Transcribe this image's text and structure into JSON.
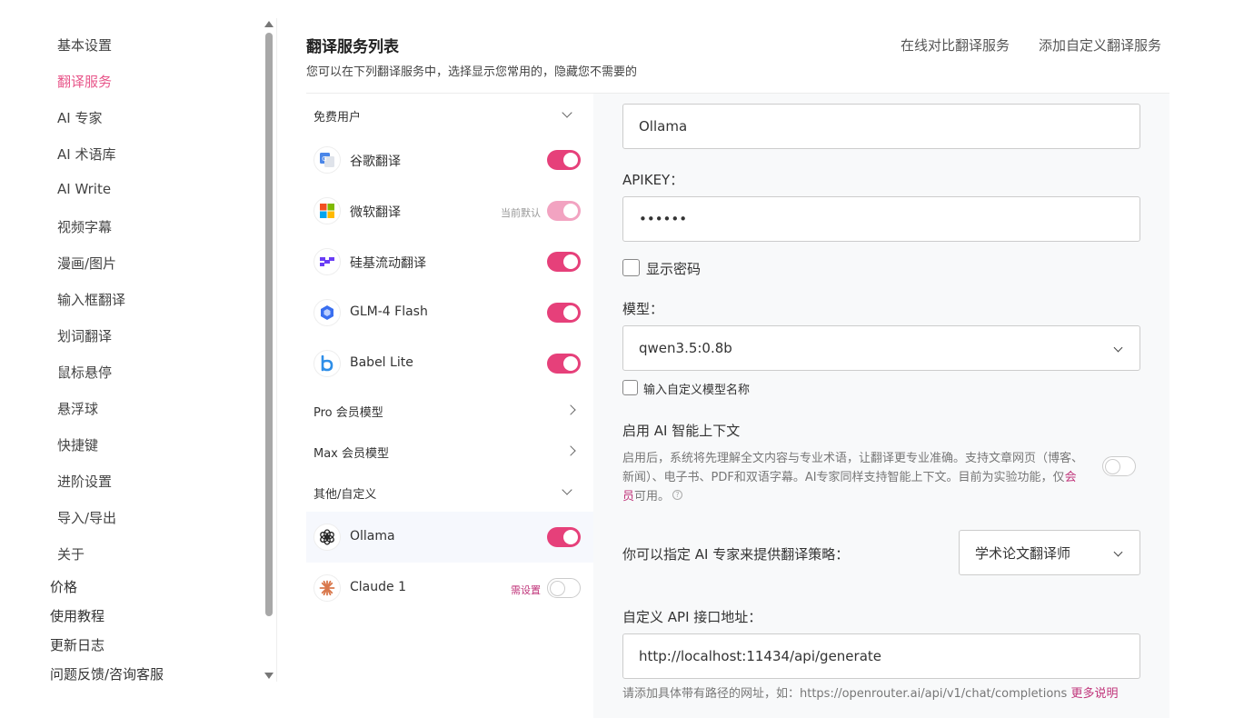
{
  "sidebar": {
    "items": [
      "基本设置",
      "翻译服务",
      "AI 专家",
      "AI 术语库",
      "AI Write",
      "视频字幕",
      "漫画/图片",
      "输入框翻译",
      "划词翻译",
      "鼠标悬停",
      "悬浮球",
      "快捷键",
      "进阶设置",
      "导入/导出",
      "关于"
    ],
    "top_items": [
      "价格",
      "使用教程",
      "更新日志",
      "问题反馈/咨询客服"
    ]
  },
  "header": {
    "title": "翻译服务列表",
    "subtitle": "您可以在下列翻译服务中，选择显示您常用的，隐藏您不需要的",
    "link_compare": "在线对比翻译服务",
    "link_add": "添加自定义翻译服务"
  },
  "services": {
    "group_free": "免费用户",
    "group_pro": "Pro 会员模型",
    "group_max": "Max 会员模型",
    "group_other": "其他/自定义",
    "free": [
      {
        "name": "谷歌翻译",
        "note": ""
      },
      {
        "name": "微软翻译",
        "note": "当前默认"
      },
      {
        "name": "硅基流动翻译",
        "note": ""
      },
      {
        "name": "GLM-4 Flash",
        "note": ""
      },
      {
        "name": "Babel Lite",
        "note": ""
      }
    ],
    "other": [
      {
        "name": "Ollama",
        "note": ""
      },
      {
        "name": "Claude 1",
        "note": "需设置"
      }
    ]
  },
  "config": {
    "name_value": "Ollama",
    "apikey_label": "APIKEY：",
    "apikey_value": "••••••",
    "show_password": "显示密码",
    "model_label": "模型：",
    "model_value": "qwen3.5:0.8b",
    "custom_model": "输入自定义模型名称",
    "ai_context_title": "启用 AI 智能上下文",
    "ai_context_desc": "启用后，系统将先理解全文内容与专业术语，让翻译更专业准确。支持文章网页（博客、新闻）、电子书、PDF和双语字幕。AI专家同样支持智能上下文。目前为实验功能，仅",
    "ai_context_vip": "会员",
    "ai_context_tail": "可用。",
    "help_mark": "?",
    "expert_label": "你可以指定 AI 专家来提供翻译策略：",
    "expert_value": "学术论文翻译师",
    "api_label": "自定义 API 接口地址：",
    "api_value": "http://localhost:11434/api/generate",
    "api_hint": "请添加具体带有路径的网址，如：https://openrouter.ai/api/v1/chat/completions",
    "api_more": "更多说明"
  },
  "colors": {
    "accent": "#e6407a",
    "accent_text": "#e8568a",
    "vip": "#c0347a"
  }
}
